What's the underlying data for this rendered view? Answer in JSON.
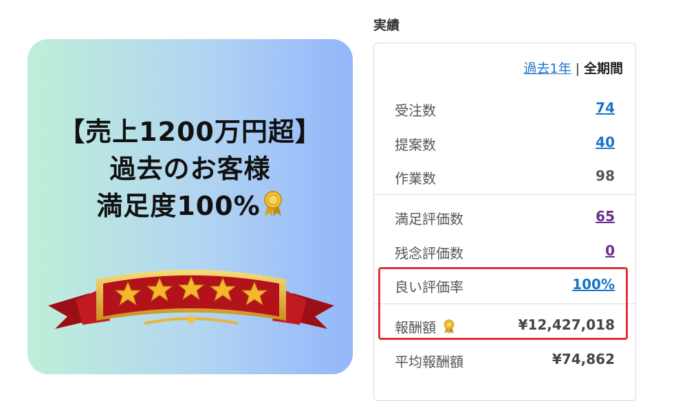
{
  "promo": {
    "line1": "【売上1200万円超】",
    "line2": "過去のお客様",
    "line3": "満足度100%",
    "medal_icon": "rosette-medal-icon",
    "banner_icon": "five-star-ribbon-banner",
    "colors": {
      "gradient_start": "#bfefd9",
      "gradient_end": "#93b6fb",
      "banner_red": "#b3121b",
      "star_gold": "#f5b72b"
    }
  },
  "stats": {
    "title": "実績",
    "period": {
      "past_year": "過去1年",
      "separator": "|",
      "all_time": "全期間"
    },
    "rows": [
      {
        "label": "受注数",
        "value": "74"
      },
      {
        "label": "提案数",
        "value": "40"
      },
      {
        "label": "作業数",
        "value": "98"
      },
      {
        "label": "満足評価数",
        "value": "65"
      },
      {
        "label": "残念評価数",
        "value": "0"
      },
      {
        "label": "良い評価率",
        "value": "100%"
      },
      {
        "label": "報酬額",
        "value": "¥12,427,018"
      },
      {
        "label": "平均報酬額",
        "value": "¥74,862"
      }
    ],
    "highlight_color": "#e0323c",
    "link_color": "#1a73c9"
  }
}
